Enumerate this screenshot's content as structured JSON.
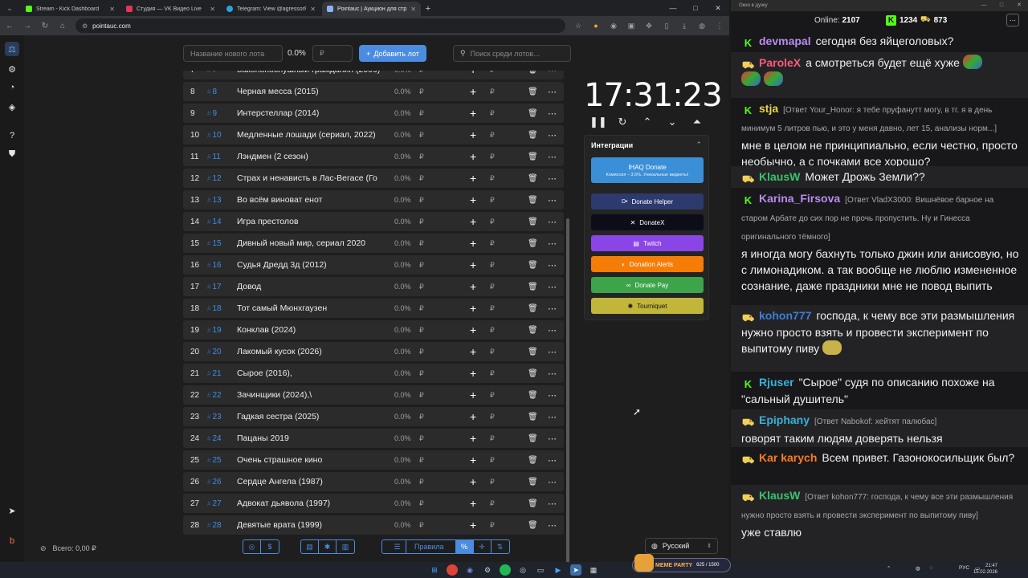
{
  "browser": {
    "tabs": [
      {
        "title": "Stream - Kick Dashboard",
        "favicon_color": "#53fc18"
      },
      {
        "title": "Студия — VK Видео Live",
        "favicon_color": "#e8335a"
      },
      {
        "title": "Telegram: View @agressorR23",
        "favicon_color": "#2aa3e0"
      },
      {
        "title": "Pointauc | Аукцион для стрим…",
        "favicon_color": "#8ab4f8"
      }
    ],
    "url": "pointauc.com"
  },
  "toolbar": {
    "lot_name_placeholder": "Название нового лота",
    "percent": "0.0%",
    "amount_placeholder": "₽",
    "add_label": "Добавить лот",
    "search_placeholder": "Поиск среди лотов..."
  },
  "lots": [
    {
      "index": "7",
      "fid": "7",
      "name": "Законопослушный гражданин (2009)",
      "percent": "0.0%",
      "cur": "₽"
    },
    {
      "index": "8",
      "fid": "8",
      "name": "Черная месса (2015)",
      "percent": "0.0%",
      "cur": "₽"
    },
    {
      "index": "9",
      "fid": "9",
      "name": "Интерстеллар (2014)",
      "percent": "0.0%",
      "cur": "₽"
    },
    {
      "index": "10",
      "fid": "10",
      "name": "Медленные лошади (сериал, 2022)",
      "percent": "0.0%",
      "cur": "₽"
    },
    {
      "index": "11",
      "fid": "11",
      "name": "Лэндмен (2 сезон)",
      "percent": "0.0%",
      "cur": "₽"
    },
    {
      "index": "12",
      "fid": "12",
      "name": "Страх и ненависть в Лас-Вегасе (Го",
      "percent": "0.0%",
      "cur": "₽"
    },
    {
      "index": "13",
      "fid": "13",
      "name": "Во всём виноват енот",
      "percent": "0.0%",
      "cur": "₽"
    },
    {
      "index": "14",
      "fid": "14",
      "name": "Игра престолов",
      "percent": "0.0%",
      "cur": "₽"
    },
    {
      "index": "15",
      "fid": "15",
      "name": "Дивный новый мир, сериал 2020",
      "percent": "0.0%",
      "cur": "₽"
    },
    {
      "index": "16",
      "fid": "16",
      "name": "Судья Дредд 3д (2012)",
      "percent": "0.0%",
      "cur": "₽"
    },
    {
      "index": "17",
      "fid": "17",
      "name": "Довод",
      "percent": "0.0%",
      "cur": "₽"
    },
    {
      "index": "18",
      "fid": "18",
      "name": "Тот самый Мюнхгаузен",
      "percent": "0.0%",
      "cur": "₽"
    },
    {
      "index": "19",
      "fid": "19",
      "name": "Конклав (2024)",
      "percent": "0.0%",
      "cur": "₽"
    },
    {
      "index": "20",
      "fid": "20",
      "name": "Лакомый кусок (2026)",
      "percent": "0.0%",
      "cur": "₽"
    },
    {
      "index": "21",
      "fid": "21",
      "name": "Сырое (2016),",
      "percent": "0.0%",
      "cur": "₽"
    },
    {
      "index": "22",
      "fid": "22",
      "name": "Зачинщики (2024),\\",
      "percent": "0.0%",
      "cur": "₽"
    },
    {
      "index": "23",
      "fid": "23",
      "name": "Гадкая сестра (2025)",
      "percent": "0.0%",
      "cur": "₽"
    },
    {
      "index": "24",
      "fid": "24",
      "name": "Пацаны 2019",
      "percent": "0.0%",
      "cur": "₽"
    },
    {
      "index": "25",
      "fid": "25",
      "name": "Очень страшное кино",
      "percent": "0.0%",
      "cur": "₽"
    },
    {
      "index": "26",
      "fid": "26",
      "name": "Сердце Ангела (1987)",
      "percent": "0.0%",
      "cur": "₽"
    },
    {
      "index": "27",
      "fid": "27",
      "name": "Адвокат дьявола (1997)",
      "percent": "0.0%",
      "cur": "₽"
    },
    {
      "index": "28",
      "fid": "28",
      "name": "Девятые врата (1999)",
      "percent": "0.0%",
      "cur": "₽"
    }
  ],
  "timer": "17:31:23",
  "integrations": {
    "title": "Интеграции",
    "items": [
      {
        "label": "IHAQ Donate",
        "sub": "Комиссия – 3,5%. Уникальные виджеты!",
        "color": "#3a8fd6"
      },
      {
        "label": "Donate Helper",
        "color": "#2c3a6e"
      },
      {
        "label": "DonateX",
        "color": "#0d0d1a"
      },
      {
        "label": "Twitch",
        "color": "#8a45e6"
      },
      {
        "label": "Donation Alerts",
        "color": "#f57d07"
      },
      {
        "label": "Donate Pay",
        "color": "#3da44a"
      },
      {
        "label": "Tourniquet",
        "color": "#c2b63a"
      }
    ]
  },
  "footer": {
    "total": "Всего: 0,00 ₽",
    "rules": "Правила",
    "language": "Русский"
  },
  "chat": {
    "window_title": "Окно в дуэку",
    "online_label": "Online:",
    "online": "2107",
    "kick_count": "1234",
    "other_count": "873",
    "messages": [
      {
        "badge": "k",
        "user": "devmapal",
        "color": "#b98cf0",
        "reply": "",
        "text": "сегодня без яйцеголовых?"
      },
      {
        "badge": "car",
        "user": "ParoleX",
        "color": "#ff5b7a",
        "reply": "",
        "text": "а смотреться будет ещё хуже"
      },
      {
        "badge": "k",
        "user": "stja",
        "color": "#e8d34a",
        "reply": "[Ответ Your_Honor: я тебе пруфанутт могу, в тг. я в день минимум 5 литров пью, и это у меня давно, лет 15, анализы норм...]",
        "text": "мне в целом не принципиально, если честно, просто необычно, а с почками все хорошо?"
      },
      {
        "badge": "car",
        "user": "KlausW",
        "color": "#39c46b",
        "reply": "",
        "text": "Может Дрожь Земли??"
      },
      {
        "badge": "k",
        "user": "Karina_Firsova",
        "color": "#b98cf0",
        "reply": "[Ответ VladX3000: Вишнёвое барное на старом Арбате до сих пор не прочь пропустить. Ну и Гинесса оригинального тёмного]",
        "text": "я иногда могу бахнуть только джин или анисовую, но с лимонадиком. а так вообще не люблю измененное сознание, даже праздники мне не повод выпить"
      },
      {
        "badge": "car",
        "user": "kohon777",
        "color": "#3a7fd8",
        "reply": "",
        "text": "господа, к чему все эти размышления нужно просто взять и провести эксперимент по выпитому пиву"
      },
      {
        "badge": "k",
        "user": "Rjuser",
        "color": "#3ab0d8",
        "reply": "",
        "text": "\"Сырое\" судя по описанию похоже на \"сальный душитель\""
      },
      {
        "badge": "car",
        "user": "Epiphany",
        "color": "#3ab0d8",
        "reply": "[Ответ Nabokof: хейтят палюбас]",
        "text": "говорят таким людям доверять нельзя"
      },
      {
        "badge": "car",
        "user": "Kar karych",
        "color": "#ff7a1f",
        "reply": "",
        "text": "Всем привет. Газонокосильщик был?"
      },
      {
        "badge": "car",
        "user": "KlausW",
        "color": "#39c46b",
        "reply": "[Ответ kohon777: господа, к чему все эти размышления нужно просто взять и провести эксперимент по выпитому пиву]",
        "text": "уже ставлю"
      }
    ]
  },
  "taskbar": {
    "meme_party": "MEME PARTY",
    "meme_level": "625 / 1500",
    "lang": "РУС",
    "time": "21:47",
    "date": "15.02.2026"
  }
}
